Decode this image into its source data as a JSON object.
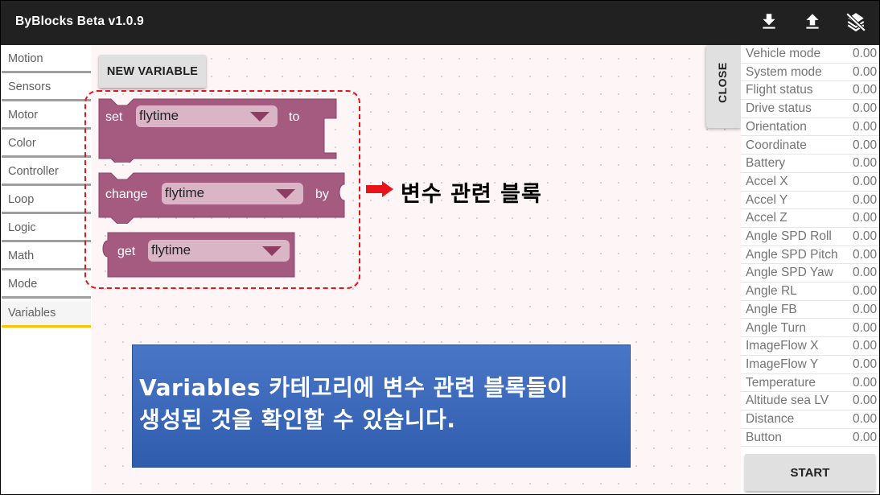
{
  "app": {
    "title": "ByBlocks Beta v1.0.9"
  },
  "toolbar": {
    "icons": [
      "download-icon",
      "upload-icon",
      "layers-off-icon"
    ]
  },
  "categories": [
    {
      "label": "Motion",
      "active": false
    },
    {
      "label": "Sensors",
      "active": false
    },
    {
      "label": "Motor",
      "active": false
    },
    {
      "label": "Color",
      "active": false
    },
    {
      "label": "Controller",
      "active": false
    },
    {
      "label": "Loop",
      "active": false
    },
    {
      "label": "Logic",
      "active": false
    },
    {
      "label": "Math",
      "active": false
    },
    {
      "label": "Mode",
      "active": false
    },
    {
      "label": "Variables",
      "active": true
    }
  ],
  "workspace": {
    "new_variable_label": "NEW VARIABLE",
    "block_color": "#a55b80",
    "blocks": {
      "set": {
        "keyword": "set",
        "variable": "flytime",
        "suffix": "to"
      },
      "change": {
        "keyword": "change",
        "variable": "flytime",
        "suffix": "by"
      },
      "get": {
        "keyword": "get",
        "variable": "flytime"
      }
    }
  },
  "annotation": {
    "arrow_label": "변수 관련 블록",
    "info_line1": "Variables 카테고리에 변수 관련 블록들이",
    "info_line2": "생성된 것을 확인할 수 있습니다."
  },
  "status_panel": {
    "close_label": "CLOSE",
    "rows": [
      {
        "label": "Vehicle mode",
        "value": "0.00"
      },
      {
        "label": "System mode",
        "value": "0.00"
      },
      {
        "label": "Flight status",
        "value": "0.00"
      },
      {
        "label": "Drive status",
        "value": "0.00"
      },
      {
        "label": "Orientation",
        "value": "0.00"
      },
      {
        "label": "Coordinate",
        "value": "0.00"
      },
      {
        "label": "Battery",
        "value": "0.00"
      },
      {
        "label": "Accel X",
        "value": "0.00"
      },
      {
        "label": "Accel Y",
        "value": "0.00"
      },
      {
        "label": "Accel Z",
        "value": "0.00"
      },
      {
        "label": "Angle SPD Roll",
        "value": "0.00"
      },
      {
        "label": "Angle SPD Pitch",
        "value": "0.00"
      },
      {
        "label": "Angle SPD Yaw",
        "value": "0.00"
      },
      {
        "label": "Angle RL",
        "value": "0.00"
      },
      {
        "label": "Angle FB",
        "value": "0.00"
      },
      {
        "label": "Angle Turn",
        "value": "0.00"
      },
      {
        "label": "ImageFlow X",
        "value": "0.00"
      },
      {
        "label": "ImageFlow Y",
        "value": "0.00"
      },
      {
        "label": "Temperature",
        "value": "0.00"
      },
      {
        "label": "Altitude sea LV",
        "value": "0.00"
      },
      {
        "label": "Distance",
        "value": "0.00"
      },
      {
        "label": "Button",
        "value": "0.00"
      }
    ],
    "start_label": "START"
  }
}
